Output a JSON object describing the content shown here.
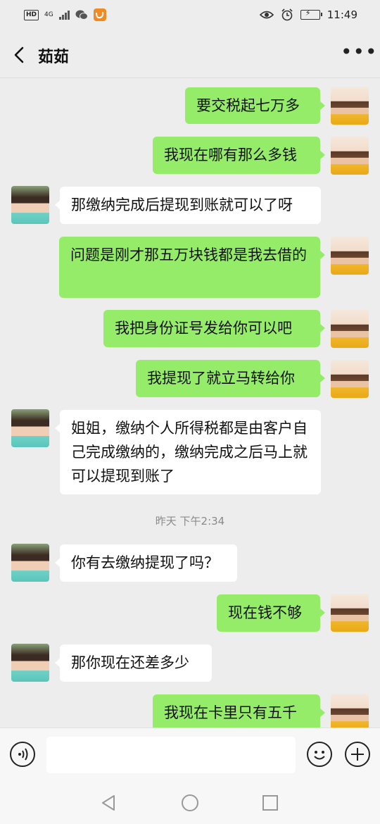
{
  "status_bar": {
    "hd": "HD",
    "network": "4G",
    "time": "11:49"
  },
  "header": {
    "title": "茹茹",
    "more": "•••"
  },
  "messages": [
    {
      "sender": "self",
      "text": "要交税起七万多"
    },
    {
      "sender": "self",
      "text": "我现在哪有那么多钱"
    },
    {
      "sender": "other",
      "text": "那缴纳完成后提现到账就可以了呀"
    },
    {
      "sender": "self",
      "text": "问题是刚才那五万块钱都是我去借的"
    },
    {
      "sender": "self",
      "text": "我把身份证号发给你可以吧"
    },
    {
      "sender": "self",
      "text": "我提现了就立马转给你"
    },
    {
      "sender": "other",
      "text": "姐姐，缴纳个人所得税都是由客户自己完成缴纳的，缴纳完成之后马上就可以提现到账了"
    },
    {
      "sender": "other",
      "text": "你有去缴纳提现了吗？"
    },
    {
      "sender": "self",
      "text": "现在钱不够"
    },
    {
      "sender": "other",
      "text": "那你现在还差多少"
    },
    {
      "sender": "self",
      "text": "我现在卡里只有五千"
    }
  ],
  "timestamp": "昨天 下午2:34",
  "input": {
    "value": "",
    "placeholder": ""
  },
  "icons": {
    "back": "back-arrow-icon",
    "voice": "voice-input-icon",
    "emoji": "emoji-icon",
    "plus": "plus-icon",
    "nav_back": "nav-back-icon",
    "nav_home": "nav-home-icon",
    "nav_recent": "nav-recent-icon"
  },
  "colors": {
    "self_bubble": "#95ec69",
    "other_bubble": "#ffffff",
    "background": "#ededed"
  }
}
